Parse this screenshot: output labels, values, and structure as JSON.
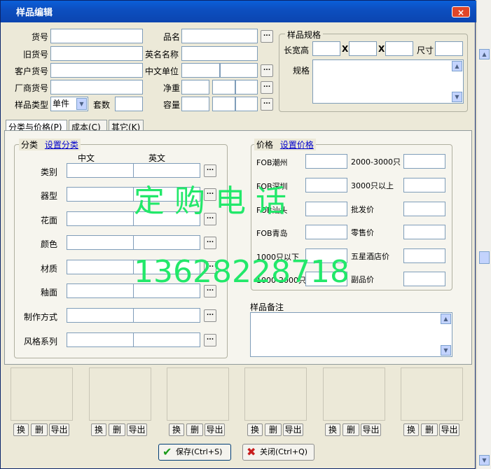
{
  "window": {
    "title": "样品编辑",
    "close_label": "×"
  },
  "fields": {
    "huohao": "货号",
    "pinming": "品名",
    "jiuhuohao": "旧货号",
    "yingming": "英名名称",
    "kehuhuohao": "客户货号",
    "zhongwendanwei": "中文单位",
    "changshanghuohao": "厂商货号",
    "jingzhong": "净重",
    "yangpinleixing": "样品类型",
    "leixing_value": "单件",
    "taoshu": "套数",
    "rongliang": "容量"
  },
  "spec": {
    "title": "样品规格",
    "dims_label": "长宽高",
    "x1": "X",
    "x2": "X",
    "size_label": "尺寸",
    "guige_label": "规格"
  },
  "tabs": [
    "分类与价格(P)",
    "成本(C)",
    "其它(K)"
  ],
  "category": {
    "title": "分类",
    "link": "设置分类",
    "col_cn": "中文",
    "col_en": "英文",
    "rows": [
      "类别",
      "器型",
      "花面",
      "颜色",
      "材质",
      "釉面",
      "制作方式",
      "风格系列"
    ]
  },
  "price": {
    "title": "价格",
    "link": "设置价格",
    "left": [
      "FOB潮州",
      "FOB深圳",
      "FOB汕头",
      "FOB青岛",
      "1000只以下",
      "1000-2000只"
    ],
    "right": [
      "2000-3000只",
      "3000只以上",
      "批发价",
      "零售价",
      "五星酒店价",
      "副品价"
    ]
  },
  "remarks_label": "样品备注",
  "image_buttons": {
    "replace": "换",
    "delete": "删",
    "export": "导出"
  },
  "bottom_buttons": {
    "save": "保存(Ctrl+S)",
    "close": "关闭(Ctrl+Q)"
  },
  "watermark": {
    "line1": "定 购 电 话",
    "line2": "13628228718"
  },
  "colors": {
    "titlebar": "#0A5FD9",
    "watermark": "#22E86A",
    "link": "#0000CC"
  }
}
